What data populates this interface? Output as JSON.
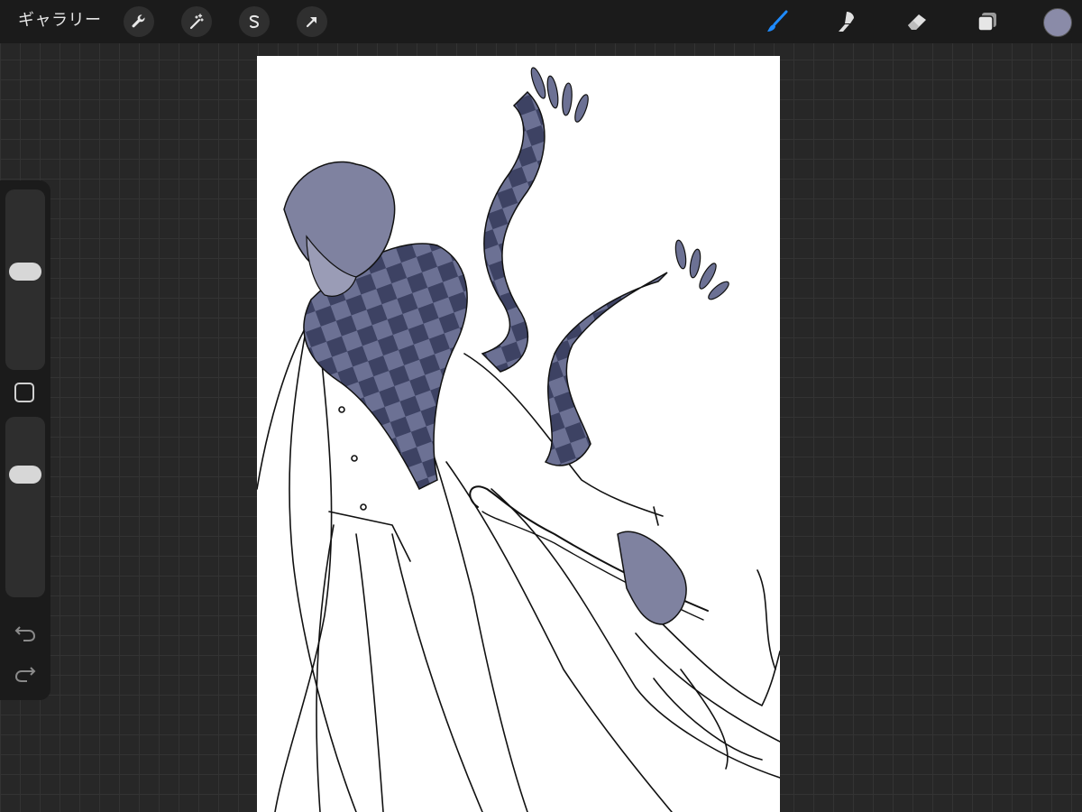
{
  "topbar": {
    "gallery_label": "ギャラリー",
    "left_tools": [
      "wrench-icon",
      "magic-wand-icon",
      "selection-icon",
      "transform-arrow-icon"
    ],
    "right_tools": [
      "brush-icon",
      "smudge-icon",
      "eraser-icon",
      "layers-icon"
    ],
    "active_tool": "brush-icon",
    "active_tool_color": "#1e8bff",
    "current_color": "#8a8ba8"
  },
  "sidebar": {
    "brush_size_level": 0.55,
    "opacity_level": 0.7,
    "modify_button": "square-icon",
    "undo": "undo-icon",
    "redo": "redo-icon"
  },
  "canvas": {
    "scarf_colors": [
      "#6c7194",
      "#3d4263"
    ],
    "artwork": "character-line-art"
  }
}
